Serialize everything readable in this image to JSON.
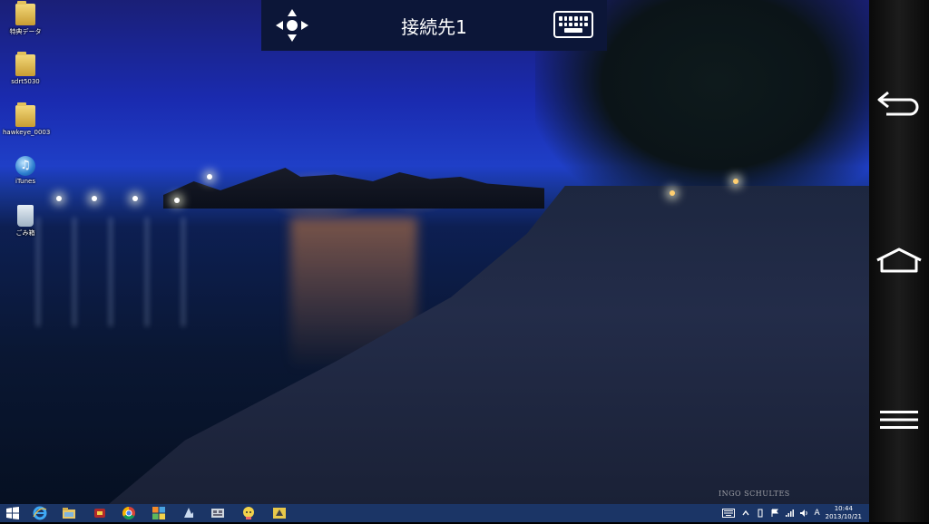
{
  "desktop": {
    "icons": [
      {
        "label": "特典データ",
        "icon": "folder-icon"
      },
      {
        "label": "sdrt5030",
        "icon": "folder-icon"
      },
      {
        "label": "hawkeye_0003",
        "icon": "folder-icon"
      },
      {
        "label": "iTunes",
        "icon": "itunes-icon"
      },
      {
        "label": "ごみ箱",
        "icon": "recycle-bin-icon"
      }
    ],
    "watermark": "INGO SCHULTES"
  },
  "remote_toolbar": {
    "title": "接続先1",
    "move_icon": "dpad-move-icon",
    "keyboard_icon": "keyboard-icon",
    "background": "#0c1638"
  },
  "android_nav": {
    "buttons": [
      {
        "name": "back",
        "icon": "back-arrow-icon"
      },
      {
        "name": "home",
        "icon": "home-icon"
      },
      {
        "name": "menu",
        "icon": "menu-icon"
      }
    ]
  },
  "taskbar": {
    "background": "#1b3566",
    "pinned": [
      "windows-start-icon",
      "internet-explorer-icon",
      "file-explorer-icon",
      "app-icon",
      "chrome-icon",
      "store-tiles-icon",
      "app-icon",
      "app-icon",
      "character-app-icon",
      "app-icon"
    ],
    "tray": {
      "ime_mode": "A",
      "time": "10:44",
      "date": "2013/10/21"
    }
  }
}
